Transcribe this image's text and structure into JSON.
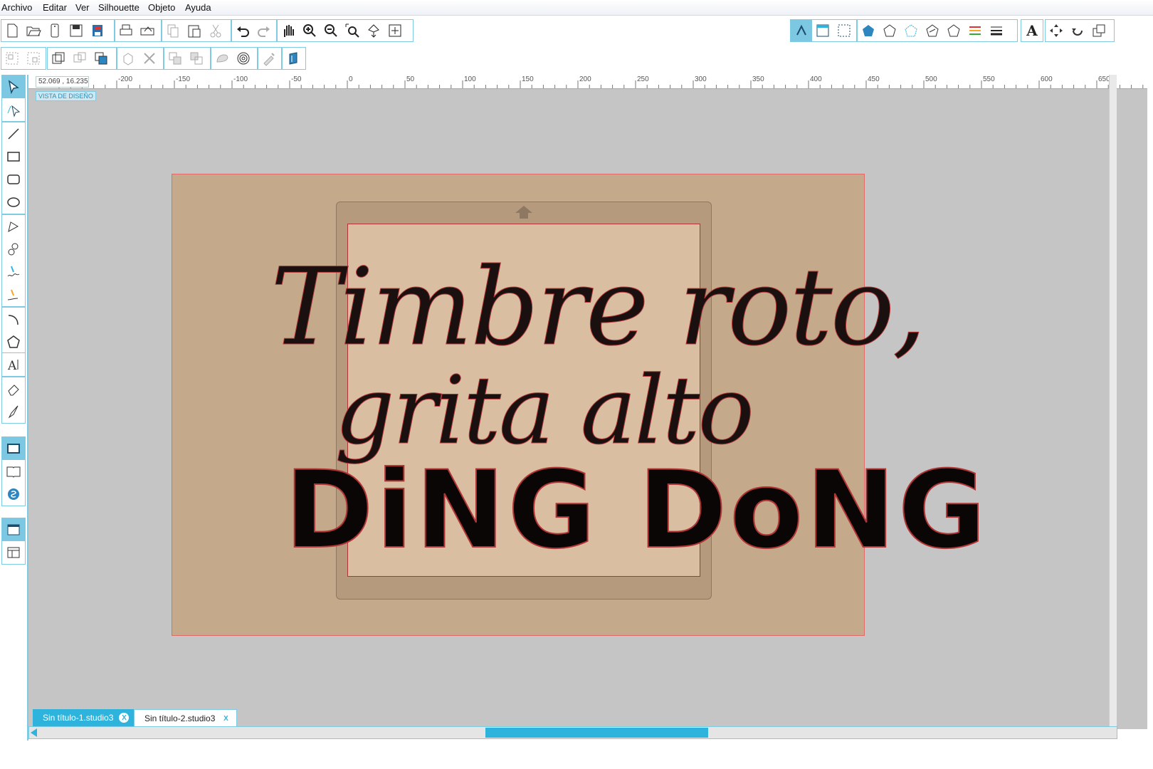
{
  "menu": [
    "Archivo",
    "Editar",
    "Ver",
    "Silhouette",
    "Objeto",
    "Ayuda"
  ],
  "toolbar_top_left": [
    "new-doc",
    "open",
    "open-library",
    "save",
    "save-library",
    "print",
    "print-cut",
    "copy",
    "paste",
    "cut",
    "undo",
    "redo",
    "pan",
    "zoom-in",
    "zoom-out",
    "zoom-selection",
    "fit-drag",
    "fit-page"
  ],
  "toolbar_top_right": [
    "page-setup",
    "registration",
    "grid",
    "fill",
    "line-style",
    "gradient",
    "pattern",
    "shadow",
    "line-color",
    "line-weight",
    "text-style",
    "transform",
    "replicate",
    "modify"
  ],
  "toolbar_second": [
    "group",
    "ungroup",
    "compound",
    "release-compound",
    "bring-to-front",
    "merge",
    "weld",
    "subtract",
    "intersect",
    "offset",
    "trace-tool",
    "knife",
    "eraser-adv"
  ],
  "coordinates": "52.069 , 16.235",
  "design_view_label": "VISTA DE DISEÑO",
  "ruler_ticks": [
    "-200",
    "-150",
    "-100",
    "-50",
    "0",
    "50",
    "100",
    "150",
    "200",
    "250",
    "300",
    "350",
    "400",
    "450",
    "500",
    "550",
    "600",
    "650"
  ],
  "canvas_text": {
    "line1": "Timbre roto,",
    "line2": "grita alto",
    "line3": "DiNG DoNG"
  },
  "tabs": [
    {
      "label": "Sin título-1.studio3",
      "close": "X"
    },
    {
      "label": "Sin título-2.studio3",
      "close": "X"
    }
  ],
  "colors": {
    "accent": "#2eb3dc",
    "page": "#c5a98b",
    "mat": "#b59a7e",
    "cut_area": "#d9bea2",
    "canvas_bg": "#c5c5c5",
    "text": "#1a1010"
  }
}
